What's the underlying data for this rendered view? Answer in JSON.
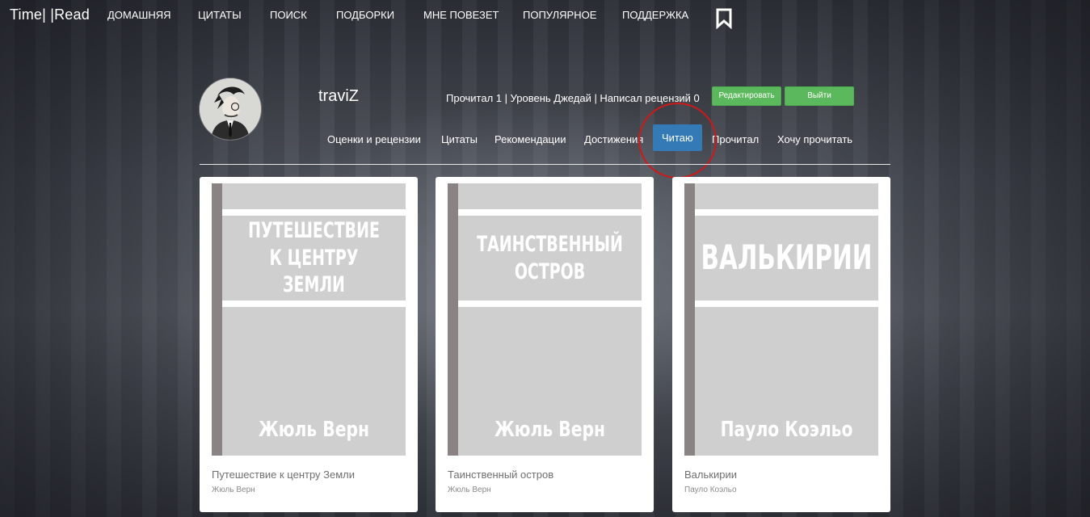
{
  "nav": {
    "brand": "Time| |Read",
    "items": [
      "ДОМАШНЯЯ",
      "ЦИТАТЫ",
      "ПОИСК",
      "ПОДБОРКИ",
      "МНЕ ПОВЕЗЕТ",
      "ПОПУЛЯРНОЕ",
      "ПОДДЕРЖКА"
    ],
    "bookmark_icon": "bookmark-icon"
  },
  "profile": {
    "username": "traviZ",
    "stats": "Прочитал 1 | Уровень Джедай | Написал рецензий 0",
    "edit_label": "Редактировать",
    "logout_label": "Выйти",
    "accent_green": "#5cb85c",
    "active_tab_color": "#337ab7"
  },
  "tabs": {
    "items": [
      "Оценки и рецензии",
      "Цитаты",
      "Рекомендации",
      "Достижения",
      "Читаю",
      "Прочитал",
      "Хочу прочитать"
    ],
    "active": "Читаю"
  },
  "books": [
    {
      "cover_title": "Путешествие к центру Земли",
      "cover_author": "Жюль Верн",
      "title": "Путешествие к центру Земли",
      "author": "Жюль Верн"
    },
    {
      "cover_title": "Таинственный остров",
      "cover_author": "Жюль Верн",
      "title": "Таинственный остров",
      "author": "Жюль Верн"
    },
    {
      "cover_title": "Валькирии",
      "cover_author": "Пауло Коэльо",
      "title": "Валькирии",
      "author": "Пауло Коэльо"
    }
  ]
}
